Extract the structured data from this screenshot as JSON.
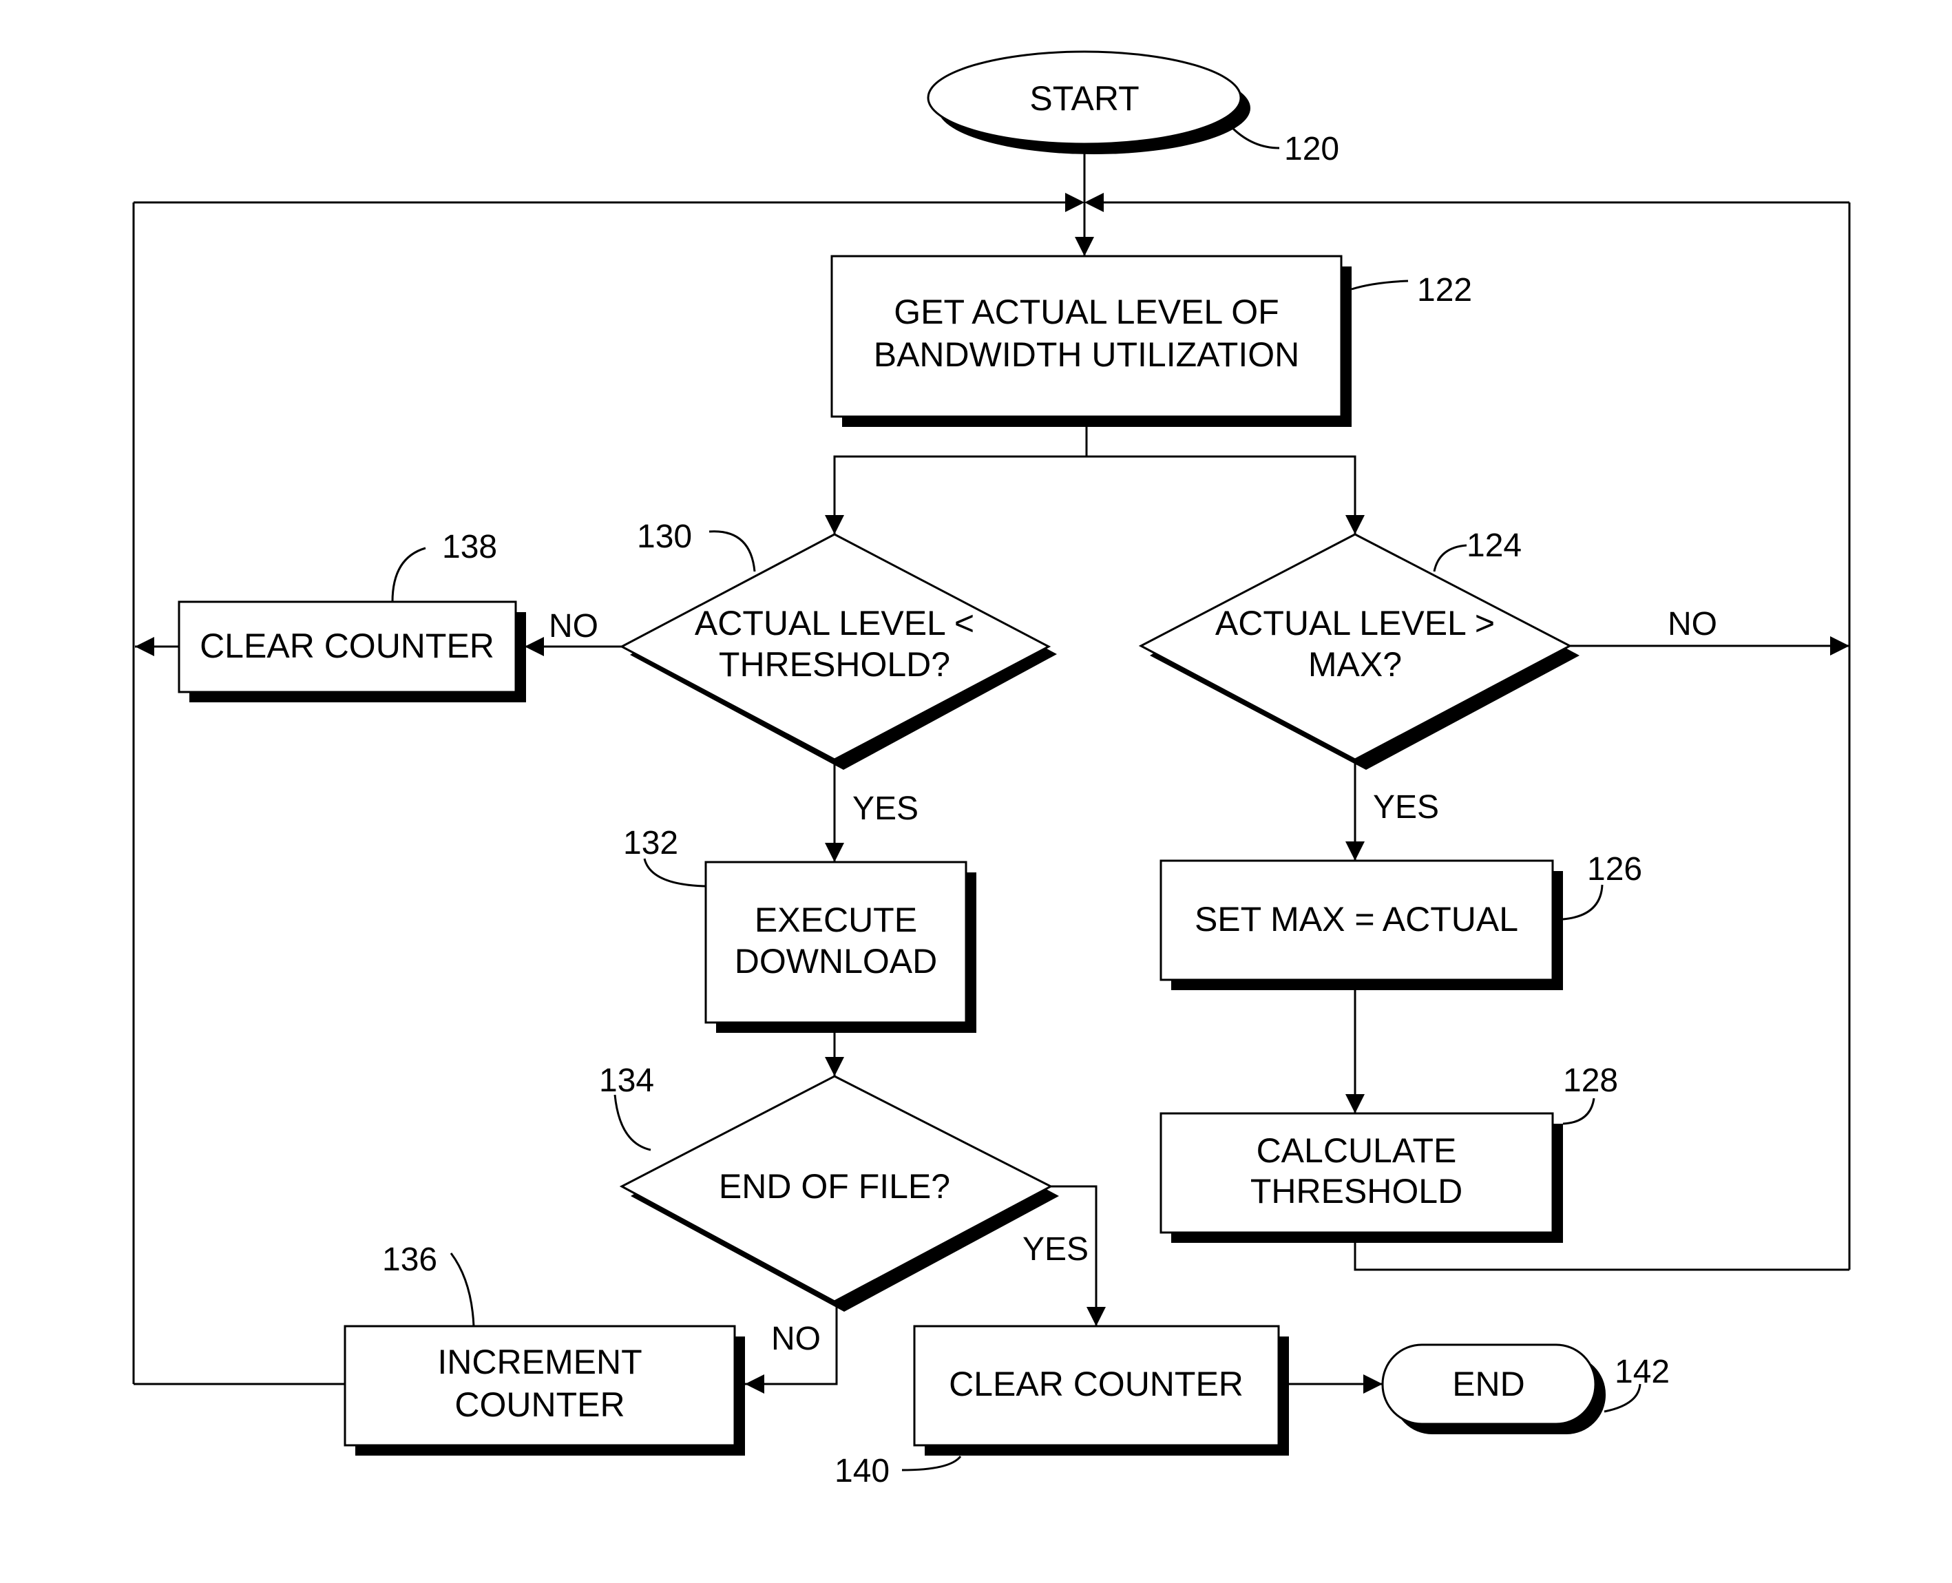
{
  "diagram": {
    "type": "flowchart",
    "nodes": {
      "start": {
        "ref": "120",
        "lines": [
          "START"
        ]
      },
      "get_level": {
        "ref": "122",
        "lines": [
          "GET ACTUAL LEVEL OF",
          "BANDWIDTH UTILIZATION"
        ]
      },
      "check_max": {
        "ref": "124",
        "lines": [
          "ACTUAL LEVEL >",
          "MAX?"
        ]
      },
      "set_max": {
        "ref": "126",
        "lines": [
          "SET MAX = ACTUAL"
        ]
      },
      "calc_threshold": {
        "ref": "128",
        "lines": [
          "CALCULATE",
          "THRESHOLD"
        ]
      },
      "check_threshold": {
        "ref": "130",
        "lines": [
          "ACTUAL LEVEL <",
          "THRESHOLD?"
        ]
      },
      "execute_download": {
        "ref": "132",
        "lines": [
          "EXECUTE",
          "DOWNLOAD"
        ]
      },
      "end_of_file": {
        "ref": "134",
        "lines": [
          "END OF FILE?"
        ]
      },
      "increment_counter": {
        "ref": "136",
        "lines": [
          "INCREMENT",
          "COUNTER"
        ]
      },
      "clear_counter_a": {
        "ref": "138",
        "lines": [
          "CLEAR COUNTER"
        ]
      },
      "clear_counter_b": {
        "ref": "140",
        "lines": [
          "CLEAR COUNTER"
        ]
      },
      "end": {
        "ref": "142",
        "lines": [
          "END"
        ]
      }
    },
    "edge_labels": {
      "threshold_no": "NO",
      "threshold_yes": "YES",
      "max_no": "NO",
      "max_yes": "YES",
      "eof_yes": "YES",
      "eof_no": "NO"
    },
    "edges": [
      {
        "from": "start",
        "to": "get_level"
      },
      {
        "from": "get_level",
        "to": "check_threshold"
      },
      {
        "from": "get_level",
        "to": "check_max"
      },
      {
        "from": "check_threshold",
        "to": "clear_counter_a",
        "label": "NO"
      },
      {
        "from": "check_threshold",
        "to": "execute_download",
        "label": "YES"
      },
      {
        "from": "clear_counter_a",
        "to": "get_level"
      },
      {
        "from": "execute_download",
        "to": "end_of_file"
      },
      {
        "from": "end_of_file",
        "to": "increment_counter",
        "label": "NO"
      },
      {
        "from": "end_of_file",
        "to": "clear_counter_b",
        "label": "YES"
      },
      {
        "from": "increment_counter",
        "to": "get_level"
      },
      {
        "from": "clear_counter_b",
        "to": "end"
      },
      {
        "from": "check_max",
        "to": "set_max",
        "label": "YES"
      },
      {
        "from": "check_max",
        "to": "get_level",
        "label": "NO"
      },
      {
        "from": "set_max",
        "to": "calc_threshold"
      },
      {
        "from": "calc_threshold",
        "to": "get_level"
      }
    ]
  }
}
